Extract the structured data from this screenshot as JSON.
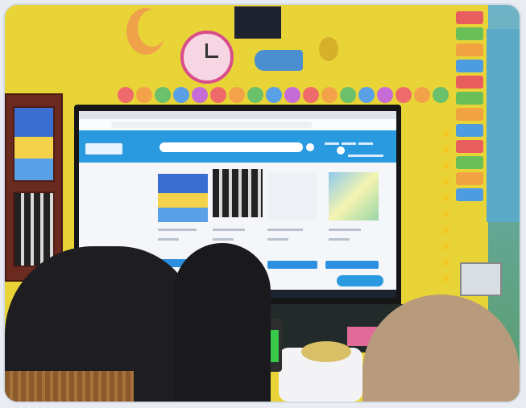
{
  "scene": {
    "tv_screen": {
      "site_header_small": "",
      "chat_button": "",
      "product_labels": [
        "",
        "",
        "",
        ""
      ]
    }
  },
  "colors": {
    "wall": "#e9d437",
    "site_header": "#2a9ae0",
    "phone_screen": "#38c84a",
    "hijab_beige": "#b89b7c"
  }
}
